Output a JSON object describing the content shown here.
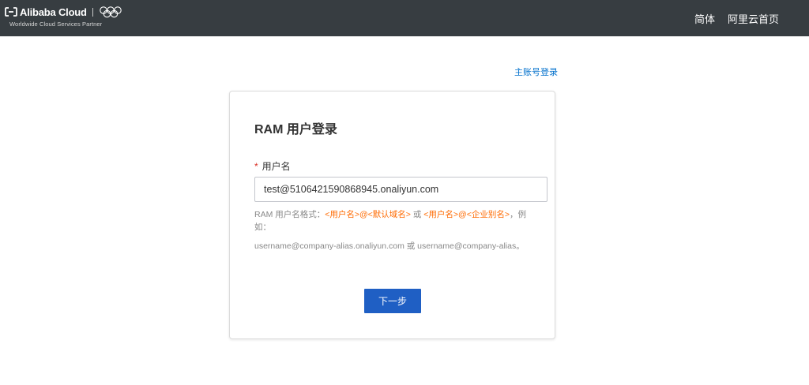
{
  "header": {
    "brand": "Alibaba Cloud",
    "tagline": "Worldwide Cloud Services Partner",
    "links": [
      "简体",
      "阿里云首页"
    ]
  },
  "main_account_login": "主账号登录",
  "login_card": {
    "title": "RAM 用户登录",
    "field_required_mark": "*",
    "field_label": "用户名",
    "username_value": "test@5106421590868945.onaliyun.com",
    "hint": {
      "prefix": "RAM 用户名格式：",
      "format1": "<用户名>@<默认域名>",
      "or1": " 或 ",
      "format2": "<用户名>@<企业别名>",
      "suffix": "，例如：",
      "example": "username@company-alias.onaliyun.com 或 username@company-alias。"
    },
    "next_button": "下一步"
  },
  "colors": {
    "topbar": "#373d41",
    "link": "#0070cc",
    "highlight": "#ff6a00",
    "primary_button": "#1f5fc4"
  }
}
